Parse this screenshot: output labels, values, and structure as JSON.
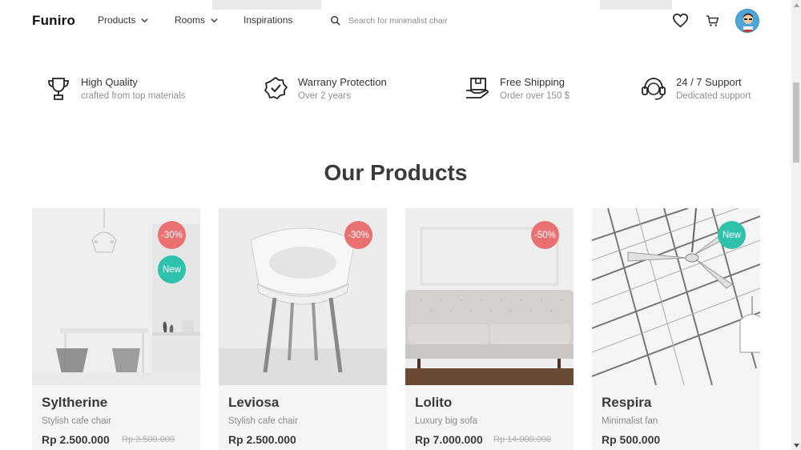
{
  "header": {
    "logo": "Funiro",
    "nav": [
      {
        "label": "Products",
        "has_dropdown": true
      },
      {
        "label": "Rooms",
        "has_dropdown": true
      },
      {
        "label": "Inspirations",
        "has_dropdown": false
      }
    ],
    "search": {
      "placeholder": "Search for minimalist chair",
      "value": ""
    },
    "icons": [
      "heart-icon",
      "cart-icon",
      "user-avatar"
    ]
  },
  "features": [
    {
      "icon": "trophy-icon",
      "title": "High Quality",
      "subtitle": "crafted from top materials"
    },
    {
      "icon": "guarantee-check-icon",
      "title": "Warrany Protection",
      "subtitle": "Over 2 years"
    },
    {
      "icon": "shipping-box-icon",
      "title": "Free Shipping",
      "subtitle": "Order over 150 $"
    },
    {
      "icon": "headset-support-icon",
      "title": "24 / 7 Support",
      "subtitle": "Dedicated support"
    }
  ],
  "section_title": "Our Products",
  "products": [
    {
      "name": "Syltherine",
      "description": "Stylish cafe chair",
      "price": "Rp 2.500.000",
      "old_price": "Rp 3.500.000",
      "badges": [
        "-30%",
        "New"
      ]
    },
    {
      "name": "Leviosa",
      "description": "Stylish cafe chair",
      "price": "Rp 2.500.000",
      "old_price": "",
      "badges": [
        "-30%"
      ]
    },
    {
      "name": "Lolito",
      "description": "Luxury big sofa",
      "price": "Rp 7.000.000",
      "old_price": "Rp 14.000.000",
      "badges": [
        "-50%"
      ]
    },
    {
      "name": "Respira",
      "description": "Minimalist fan",
      "price": "Rp 500.000",
      "old_price": "",
      "badges": [
        "New"
      ]
    }
  ],
  "colors": {
    "discount_badge": "#e97171",
    "new_badge": "#2ec1ac",
    "card_bg": "#f4f5f7"
  }
}
